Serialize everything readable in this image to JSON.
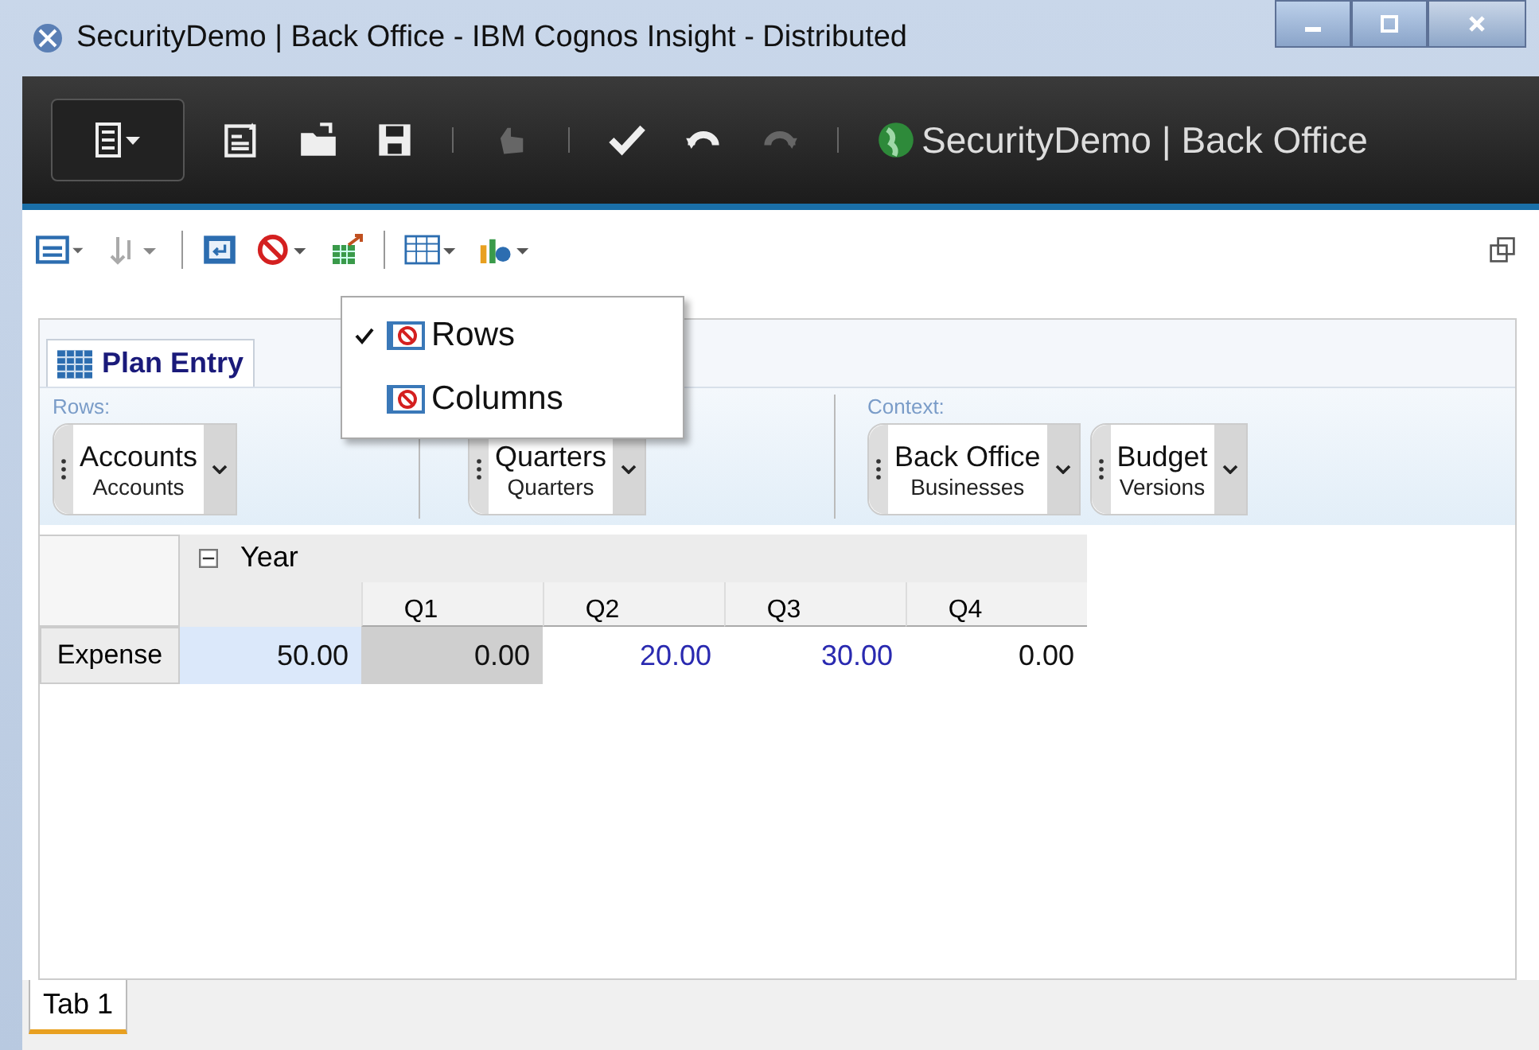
{
  "window": {
    "title": "SecurityDemo | Back Office - IBM Cognos Insight - Distributed"
  },
  "toolbar": {
    "workspace_title": "SecurityDemo | Back Office"
  },
  "menu": {
    "items": [
      {
        "label": "Rows",
        "checked": true
      },
      {
        "label": "Columns",
        "checked": false
      }
    ]
  },
  "tab": {
    "label": "Plan Entry",
    "selected": true
  },
  "dimension_areas": [
    {
      "label": "Rows:",
      "pills": [
        {
          "name": "Accounts",
          "sub": "Accounts"
        }
      ]
    },
    {
      "pills": [
        {
          "name": "Quarters",
          "sub": "Quarters"
        }
      ]
    },
    {
      "label": "Context:",
      "pills": [
        {
          "name": "Back Office",
          "sub": "Businesses"
        },
        {
          "name": "Budget",
          "sub": "Versions"
        }
      ]
    }
  ],
  "grid": {
    "year": "Year",
    "expanded": true,
    "columns": [
      "Q1",
      "Q2",
      "Q3",
      "Q4"
    ],
    "rows": [
      {
        "label": "Expense",
        "cells": [
          {
            "value": "50.00",
            "kind": "total"
          },
          {
            "value": "0.00",
            "kind": "locked"
          },
          {
            "value": "20.00",
            "kind": "edited"
          },
          {
            "value": "30.00",
            "kind": "edited"
          },
          {
            "value": "0.00",
            "kind": "normal"
          }
        ]
      }
    ]
  },
  "sheet_tabs": [
    {
      "label": "Tab 1",
      "selected": true
    }
  ]
}
